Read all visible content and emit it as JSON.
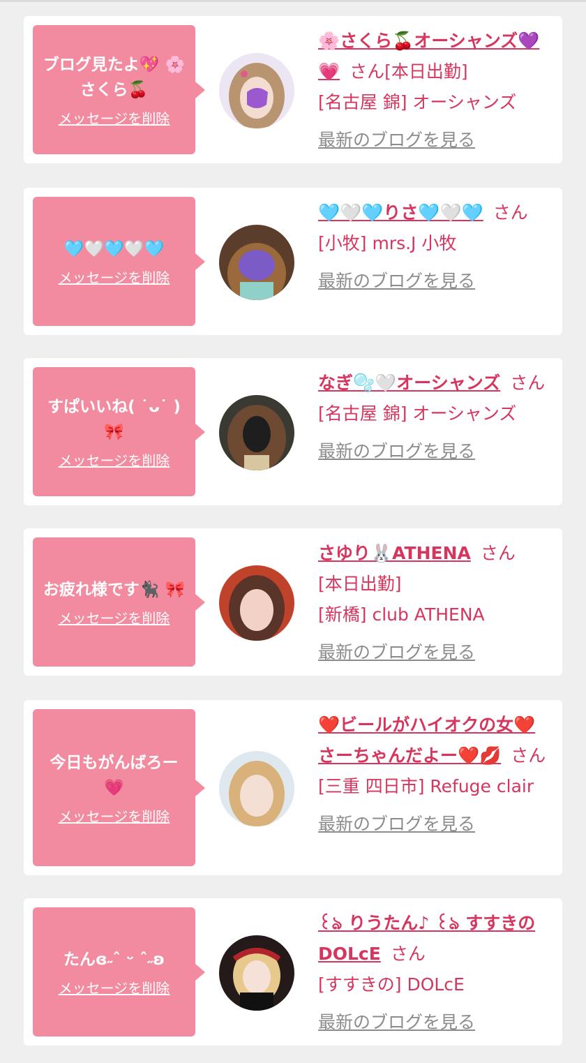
{
  "cards": [
    {
      "message": "ブログ見たよ💖 🌸さくら🍒",
      "delete_label": "メッセージを削除",
      "name": "🌸さくら🍒オーシャンズ💜💗",
      "san": "さん",
      "line1": "[本日出勤]",
      "line2": "[名古屋 錦] オーシャンズ",
      "blog_link": "最新のブログを見る"
    },
    {
      "message": "🩵🤍🩵🤍🩵",
      "delete_label": "メッセージを削除",
      "name": "🩵🤍🩵りさ🩵🤍🩵",
      "san": "さん",
      "line1": "",
      "line2": "[小牧] mrs.J 小牧",
      "blog_link": "最新のブログを見る"
    },
    {
      "message": "すぱいいね( ˙ᴗ˙ ) 🎀",
      "delete_label": "メッセージを削除",
      "name": "なぎ🫧🤍オーシャンズ",
      "san": "さん",
      "line1": "",
      "line2": "[名古屋 錦] オーシャンズ",
      "blog_link": "最新のブログを見る"
    },
    {
      "message": "お疲れ様です🐈‍⬛ 🎀",
      "delete_label": "メッセージを削除",
      "name": "さゆり🐰ATHENA",
      "san": "さん",
      "line1": "[本日出勤]",
      "line2": "[新橋] club ATHENA",
      "blog_link": "最新のブログを見る"
    },
    {
      "message": "今日もがんばろー 💗",
      "delete_label": "メッセージを削除",
      "name": "❤️ビールがハイオクの女❤️さーちゃんだよー❤️💋",
      "san": "さん",
      "line1": "",
      "line2": "[三重 四日市] Refuge clair",
      "blog_link": "最新のブログを見る"
    },
    {
      "message": "たんɞ˶ˆ ᵕ ˆ˶ʚ",
      "delete_label": "メッセージを削除",
      "name": "꒰ঌ りうたん♪ ꒰ঌ すすきのDOLcE",
      "san": "さん",
      "line1": "",
      "line2": "[すすきの] DOLcE",
      "blog_link": "最新のブログを見る"
    }
  ],
  "colors": {
    "accent": "#d6365e",
    "bubble": "#f38ba0",
    "background": "#efefef",
    "link_gray": "#8c8c8c"
  }
}
